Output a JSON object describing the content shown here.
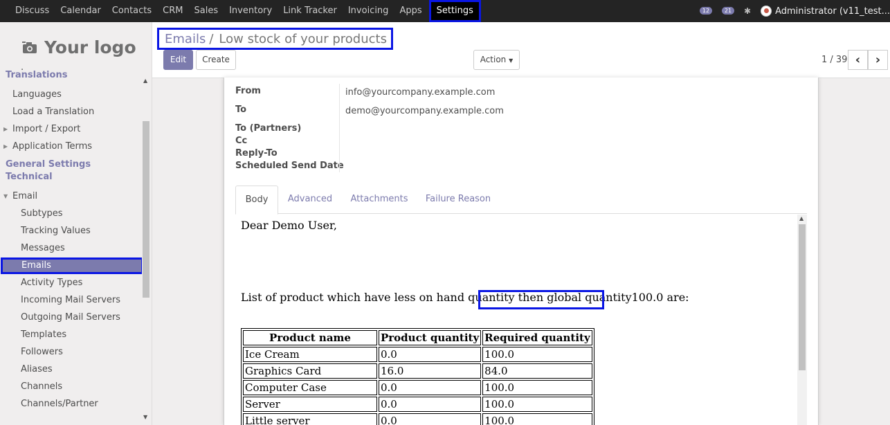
{
  "topbar": {
    "menu": [
      "Discuss",
      "Calendar",
      "Contacts",
      "CRM",
      "Sales",
      "Inventory",
      "Link Tracker",
      "Invoicing",
      "Apps"
    ],
    "active_menu": "Settings",
    "messages_count": "12",
    "chat_count": "21",
    "user": "Administrator (v11_test..."
  },
  "sidebar": {
    "logo_text": "Your logo",
    "partial_item": ".",
    "items": [
      {
        "label": "Translations",
        "type": "section"
      },
      {
        "label": "Languages",
        "type": "l1"
      },
      {
        "label": "Load a Translation",
        "type": "l1"
      },
      {
        "label": "Import / Export",
        "type": "l1-collapsed"
      },
      {
        "label": "Application Terms",
        "type": "l1-collapsed"
      },
      {
        "label": "General Settings",
        "type": "section"
      },
      {
        "label": "Technical",
        "type": "section"
      },
      {
        "label": "Email",
        "type": "l1-expanded"
      },
      {
        "label": "Subtypes",
        "type": "l2"
      },
      {
        "label": "Tracking Values",
        "type": "l2"
      },
      {
        "label": "Messages",
        "type": "l2"
      },
      {
        "label": "Emails",
        "type": "l2-selected"
      },
      {
        "label": "Activity Types",
        "type": "l2"
      },
      {
        "label": "Incoming Mail Servers",
        "type": "l2"
      },
      {
        "label": "Outgoing Mail Servers",
        "type": "l2"
      },
      {
        "label": "Templates",
        "type": "l2"
      },
      {
        "label": "Followers",
        "type": "l2"
      },
      {
        "label": "Aliases",
        "type": "l2"
      },
      {
        "label": "Channels",
        "type": "l2"
      },
      {
        "label": "Channels/Partner",
        "type": "l2"
      }
    ]
  },
  "breadcrumb": {
    "parent": "Emails",
    "separator": "/",
    "current": "Low stock of your products"
  },
  "buttons": {
    "edit": "Edit",
    "create": "Create",
    "action": "Action"
  },
  "pager": {
    "value": "1 / 39",
    "prev": "‹",
    "next": "›"
  },
  "form": {
    "from_label": "From",
    "from_value": "info@yourcompany.example.com",
    "to_label": "To",
    "to_value": "demo@yourcompany.example.com",
    "to_partners_label": "To (Partners)",
    "cc_label": "Cc",
    "reply_to_label": "Reply-To",
    "scheduled_label": "Scheduled Send Date"
  },
  "tabs": [
    "Body",
    "Advanced",
    "Attachments",
    "Failure Reason"
  ],
  "body": {
    "greeting": "Dear Demo User,",
    "intro": "List of product which have less on hand quantity then global quantity100.0 are:",
    "table": {
      "headers": [
        "Product name",
        "Product quantity",
        "Required quantity"
      ],
      "rows": [
        [
          "Ice Cream",
          "0.0",
          "100.0"
        ],
        [
          "Graphics Card",
          "16.0",
          "84.0"
        ],
        [
          "Computer Case",
          "0.0",
          "100.0"
        ],
        [
          "Server",
          "0.0",
          "100.0"
        ],
        [
          "Little server",
          "0.0",
          "100.0"
        ]
      ]
    }
  },
  "colors": {
    "accent": "#7c7bad",
    "topbar": "#242424",
    "highlight": "#0a16e4"
  }
}
